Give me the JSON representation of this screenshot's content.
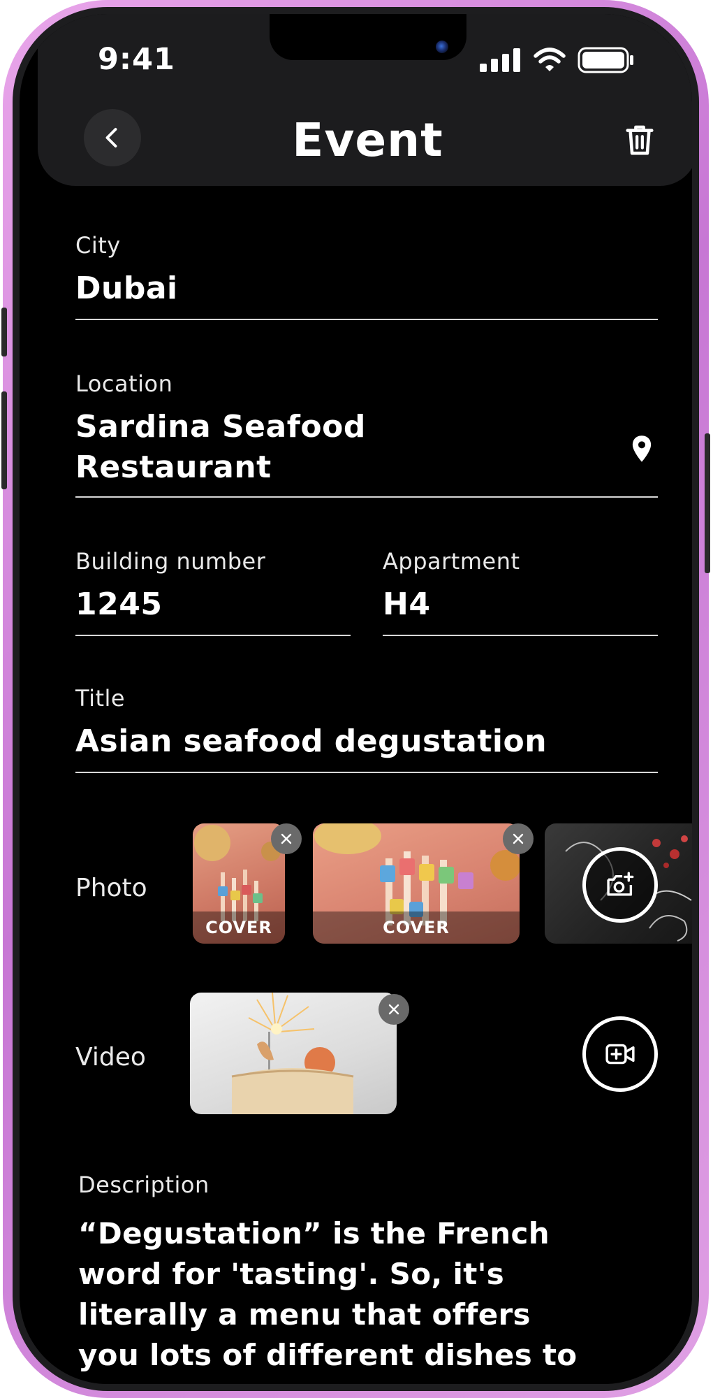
{
  "status_bar": {
    "time": "9:41"
  },
  "header": {
    "title": "Event"
  },
  "form": {
    "city": {
      "label": "City",
      "value": "Dubai"
    },
    "location": {
      "label": "Location",
      "value_line1": "Sardina Seafood",
      "value_line2": "Restaurant"
    },
    "building": {
      "label": "Building number",
      "value": "1245"
    },
    "apartment": {
      "label": "Appartment",
      "value": "H4"
    },
    "title": {
      "label": "Title",
      "value": "Asian seafood degustation"
    },
    "photo": {
      "label": "Photo",
      "cover_label": "COVER"
    },
    "video": {
      "label": "Video"
    },
    "description": {
      "label": "Description",
      "lines": [
        "“Degustation” is the French",
        "word for 'tasting'. So, it's",
        "literally a menu that offers",
        "you lots of different dishes to"
      ]
    }
  },
  "icons": {
    "back": "chevron-left-icon",
    "trash": "trash-icon",
    "location": "map-pin-icon",
    "remove": "close-icon",
    "add_photo": "camera-plus-icon",
    "add_video": "video-plus-icon"
  },
  "colors": {
    "background": "#000000",
    "header": "#1c1c1e",
    "frame": "#d48fdc",
    "text": "#ffffff"
  }
}
